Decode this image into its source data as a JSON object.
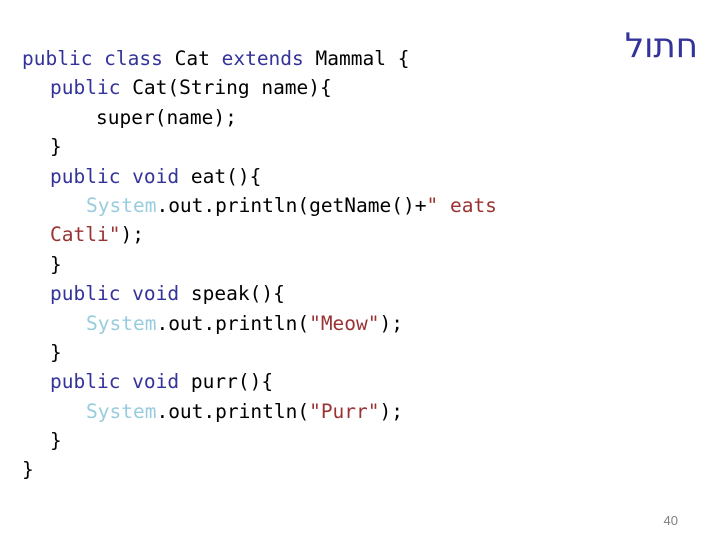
{
  "slide": {
    "title": "חתול",
    "title_color": "#333399",
    "page_number": "40",
    "background": "#ffffff"
  },
  "colors": {
    "keyword": "#333399",
    "plain": "#000000",
    "type_ref": "#99CCDD",
    "string": "#993333",
    "page_number": "#808080"
  },
  "code": {
    "language": "java",
    "lines": [
      {
        "indent": 0,
        "tokens": [
          {
            "text": "public class ",
            "kind": "keyword"
          },
          {
            "text": "Cat ",
            "kind": "plain"
          },
          {
            "text": "extends ",
            "kind": "keyword"
          },
          {
            "text": "Mammal {",
            "kind": "plain"
          }
        ]
      },
      {
        "indent": 1,
        "tokens": [
          {
            "text": "public ",
            "kind": "keyword"
          },
          {
            "text": "Cat(String name){",
            "kind": "plain"
          }
        ]
      },
      {
        "indent": 3,
        "tokens": [
          {
            "text": "super(name)",
            "kind": "plain"
          },
          {
            "text": ";",
            "kind": "punct"
          }
        ]
      },
      {
        "indent": 1,
        "tokens": [
          {
            "text": "}",
            "kind": "plain"
          }
        ]
      },
      {
        "indent": 1,
        "tokens": [
          {
            "text": "public void ",
            "kind": "keyword"
          },
          {
            "text": "eat(){",
            "kind": "plain"
          }
        ]
      },
      {
        "indent": 2,
        "tokens": [
          {
            "text": "System",
            "kind": "type_ref"
          },
          {
            "text": ".out.println(getName()+",
            "kind": "plain"
          },
          {
            "text": "\" eats ",
            "kind": "string"
          }
        ]
      },
      {
        "indent": 1,
        "tokens": [
          {
            "text": "Catli\"",
            "kind": "string"
          },
          {
            "text": ");",
            "kind": "plain"
          }
        ]
      },
      {
        "indent": 1,
        "tokens": [
          {
            "text": "}",
            "kind": "plain"
          }
        ]
      },
      {
        "indent": 1,
        "tokens": [
          {
            "text": "public void ",
            "kind": "keyword"
          },
          {
            "text": "speak(){",
            "kind": "plain"
          }
        ]
      },
      {
        "indent": 2,
        "tokens": [
          {
            "text": "System",
            "kind": "type_ref"
          },
          {
            "text": ".out.println(",
            "kind": "plain"
          },
          {
            "text": "\"Meow\"",
            "kind": "string"
          },
          {
            "text": ");",
            "kind": "plain"
          }
        ]
      },
      {
        "indent": 1,
        "tokens": [
          {
            "text": "}",
            "kind": "plain"
          }
        ]
      },
      {
        "indent": 1,
        "tokens": [
          {
            "text": "public void ",
            "kind": "keyword"
          },
          {
            "text": "purr(){",
            "kind": "plain"
          }
        ]
      },
      {
        "indent": 2,
        "tokens": [
          {
            "text": "System",
            "kind": "type_ref"
          },
          {
            "text": ".out.println(",
            "kind": "plain"
          },
          {
            "text": "\"Purr\"",
            "kind": "string"
          },
          {
            "text": ");",
            "kind": "plain"
          }
        ]
      },
      {
        "indent": 1,
        "tokens": [
          {
            "text": "}",
            "kind": "plain"
          }
        ]
      },
      {
        "indent": 0,
        "tokens": [
          {
            "text": "}",
            "kind": "plain"
          }
        ]
      }
    ]
  }
}
